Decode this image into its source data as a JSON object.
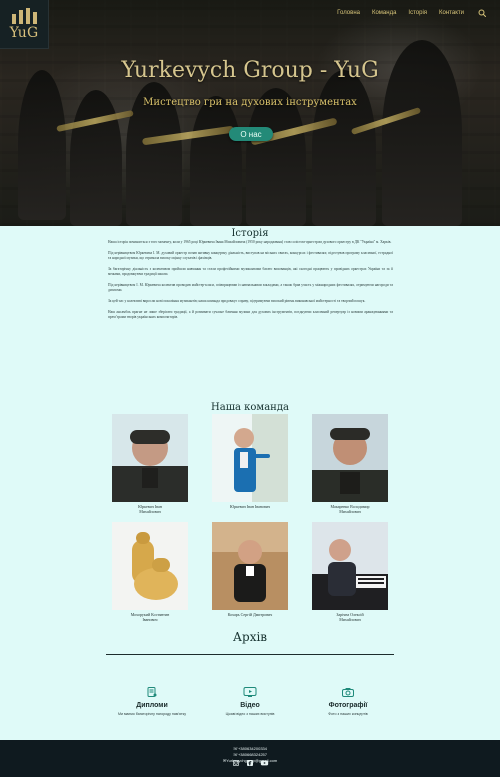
{
  "logo": {
    "text": "YuG"
  },
  "nav": {
    "items": [
      "Головна",
      "Команда",
      "Історія",
      "Контакти"
    ]
  },
  "hero": {
    "title": "Yurkevych Group - YuG",
    "subtitle": "Мистецтво гри на духових інструментах",
    "button_label": "О нас"
  },
  "history": {
    "title": "Історія",
    "paragraphs": [
      "Наша історія починається з того моменту, коли у 1965 році Юркевича Івана Михайловича (1950 року народження) став солістом-оркестром духового оркестру в ДК \"Україна\" м. Харків.",
      "Під керівництвом Юркевича І. М. духовий оркестр почав активну концертну діяльність, виступав на міських святах, конкурсах і фестивалях; підготував програму класичної, естрадної та народної музики, що отримала високу оцінку слухачів і фахівців.",
      "За багаторічну діяльність з колективом пройшли навчання та стали професійними музикантами багато вихованців, які сьогодні працюють у провідних оркестрах України та за її межами, продовжуючи традиції школи.",
      "Під керівництвом І. М. Юркевича колектив проводив майстер-класи, співпрацював із навчальними закладами, а також брав участь у міжнародних фестивалях, отримуючи нагороди та дипломи.",
      "За цей час у колективі виросли нові покоління музикантів; наша команда продовжує справу, підтримуючи високий рівень виконавської майстерності та творчий пошук.",
      "Наш ансамбль прагне не лише зберігати традиції, а й розвивати сучасне бачення музики для духових інструментів, поєднуючи класичний репертуар із новими аранжуваннями та прем’єрами творів українських композиторів."
    ]
  },
  "team": {
    "title": "Наша команда",
    "members": [
      {
        "name": "Юркевич Іван\nМихайлович",
        "avatar": "portrait-officer"
      },
      {
        "name": "Юркевич Іван Іванович",
        "avatar": "portrait-conductor"
      },
      {
        "name": "Макаренко Володимир\nМихайлович",
        "avatar": "portrait-officer2"
      },
      {
        "name": "Мохорукий Костянтин\nІванович",
        "avatar": "tuba"
      },
      {
        "name": "Кохарь Сергій Дмитрович",
        "avatar": "portrait-jacket"
      },
      {
        "name": "Зарічна Олексій\nМихайлович",
        "avatar": "pianist"
      }
    ]
  },
  "archive": {
    "title": "Архів",
    "items": [
      {
        "title": "Дипломи",
        "desc": "Ми маємо багаторічну нагороду пам'ятку",
        "icon": "diploma-icon"
      },
      {
        "title": "Відео",
        "desc": "Цікаві відео з наших виступів",
        "icon": "video-icon"
      },
      {
        "title": "Фотографії",
        "desc": "Фото з наших концертів",
        "icon": "camera-icon"
      }
    ]
  },
  "footer": {
    "phone1": "☏+380634200334",
    "phone2": "☏+380668324257",
    "email": "✉Yurkevychgroup@gmail.com",
    "social": [
      "instagram-icon",
      "facebook-icon",
      "youtube-icon"
    ]
  },
  "colors": {
    "accent": "#238a78",
    "gold": "#d8c57a",
    "background": "#dffaf8",
    "footer": "#0f1a1f"
  }
}
